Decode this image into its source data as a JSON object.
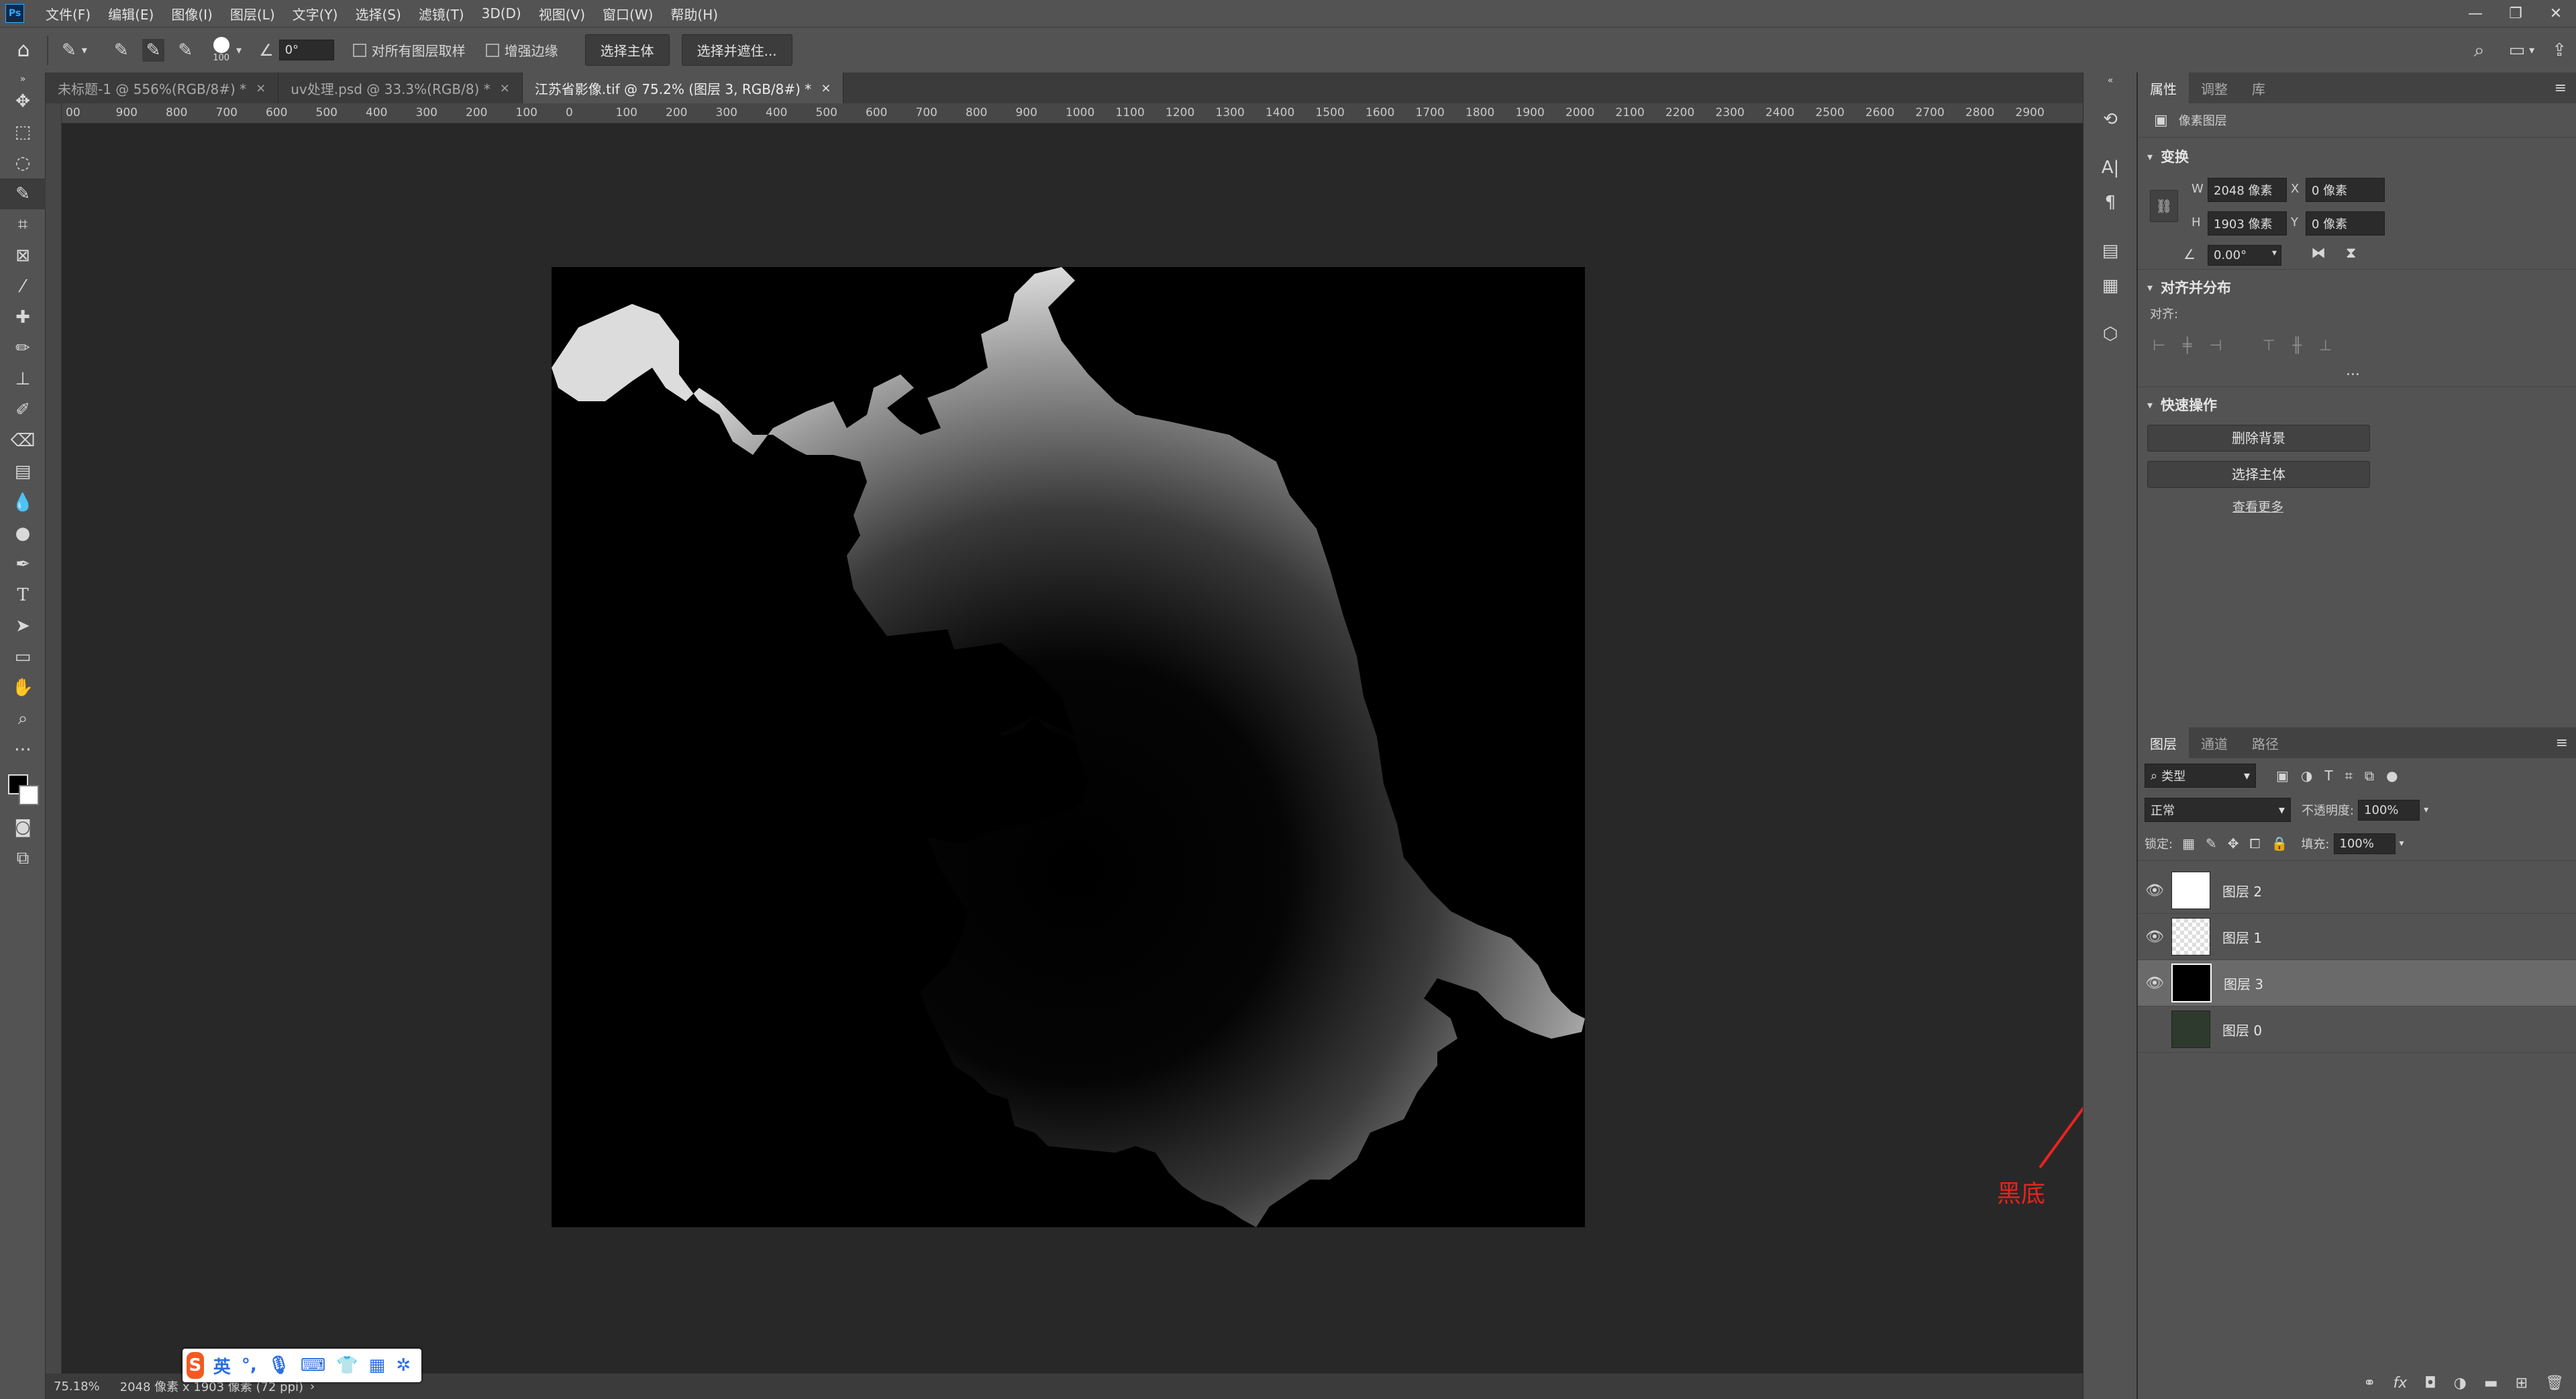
{
  "app": {
    "logo": "Ps"
  },
  "menu": [
    "文件(F)",
    "编辑(E)",
    "图像(I)",
    "图层(L)",
    "文字(Y)",
    "选择(S)",
    "滤镜(T)",
    "3D(D)",
    "视图(V)",
    "窗口(W)",
    "帮助(H)"
  ],
  "options": {
    "brush_size": "100",
    "angle": "0°",
    "sample_all_layers": "对所有图层取样",
    "enhance_edge": "增强边缘",
    "select_subject": "选择主体",
    "select_and_mask": "选择并遮住..."
  },
  "tabs": [
    {
      "label": "未标题-1 @ 556%(RGB/8#) *",
      "close": "×"
    },
    {
      "label": "uv处理.psd @ 33.3%(RGB/8) *",
      "close": "×"
    },
    {
      "label": "江苏省影像.tif @ 75.2% (图层 3, RGB/8#) *",
      "close": "×"
    }
  ],
  "ruler_labels": [
    "00",
    "900",
    "800",
    "700",
    "600",
    "500",
    "400",
    "300",
    "200",
    "100",
    "0",
    "100",
    "200",
    "300",
    "400",
    "500",
    "600",
    "700",
    "800",
    "900",
    "1000",
    "1100",
    "1200",
    "1300",
    "1400",
    "1500",
    "1600",
    "1700",
    "1800",
    "1900",
    "2000",
    "2100",
    "2200",
    "2300",
    "2400",
    "2500",
    "2600",
    "2700",
    "2800",
    "2900"
  ],
  "status": {
    "zoom": "75.18%",
    "doc_info": "2048 像素 x 1903 像素 (72 ppi)"
  },
  "ime": {
    "lang": "英"
  },
  "properties": {
    "tabs": [
      "属性",
      "调整",
      "库"
    ],
    "layer_type": "像素图层",
    "transform_title": "变换",
    "w_label": "W",
    "w_value": "2048 像素",
    "h_label": "H",
    "h_value": "1903 像素",
    "x_label": "X",
    "x_value": "0 像素",
    "y_label": "Y",
    "y_value": "0 像素",
    "angle_value": "0.00°",
    "align_title": "对齐并分布",
    "align_label": "对齐:",
    "more": "...",
    "quick_title": "快速操作",
    "remove_bg": "删除背景",
    "select_subject": "选择主体",
    "see_more": "查看更多"
  },
  "layers_panel": {
    "tabs": [
      "图层",
      "通道",
      "路径"
    ],
    "filter": "类型",
    "blend_mode": "正常",
    "opacity_label": "不透明度:",
    "opacity": "100%",
    "lock_label": "锁定:",
    "fill_label": "填充:",
    "fill": "100%",
    "layers": [
      {
        "name": "图层 2",
        "selected": false
      },
      {
        "name": "图层 1",
        "selected": false
      },
      {
        "name": "图层 3",
        "selected": true
      },
      {
        "name": "图层 0",
        "selected": false
      }
    ]
  },
  "annotation": {
    "text": "黑底",
    "color": "#e8231f"
  }
}
